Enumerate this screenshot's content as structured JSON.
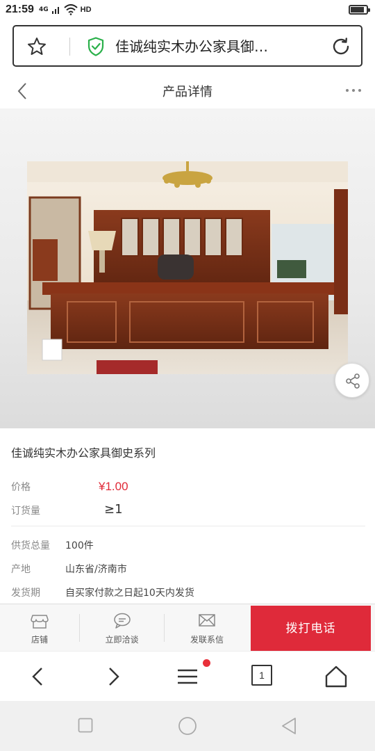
{
  "status_bar": {
    "time": "21:59",
    "signal_label": "4G",
    "network_label": "HD",
    "battery_level": 0.85
  },
  "url_bar": {
    "title": "佳诚纯实木办公家具御…",
    "star_icon": "star-outline-icon",
    "security_icon": "shield-check-icon",
    "refresh_icon": "refresh-icon",
    "shield_color": "#2ab04a"
  },
  "header": {
    "title": "产品详情",
    "back_icon": "chevron-left-icon",
    "more_icon": "more-horizontal-icon"
  },
  "gallery": {
    "image_icon": "office-desk-photo",
    "share_icon": "share-icon"
  },
  "product": {
    "name": "佳诚纯实木办公家具御史系列",
    "price_label": "价格",
    "price": "¥1.00",
    "moq_label": "订货量",
    "moq": "≥1",
    "supply_label": "供货总量",
    "supply": "100件",
    "origin_label": "产地",
    "origin": "山东省/济南市",
    "delivery_label": "发货期",
    "delivery": "自买家付款之日起10天内发货"
  },
  "actions": {
    "store_label": "店铺",
    "chat_label": "立即洽谈",
    "message_label": "发联系信",
    "call_label": "拨打电话",
    "accent_color": "#df2a3a"
  },
  "browser_toolbar": {
    "tab_count": "1",
    "icons": [
      "back-arrow-icon",
      "forward-arrow-icon",
      "menu-icon",
      "tabs-icon",
      "home-icon"
    ]
  },
  "android_nav": {
    "icons": [
      "recents-square-icon",
      "home-circle-icon",
      "back-triangle-icon"
    ]
  }
}
